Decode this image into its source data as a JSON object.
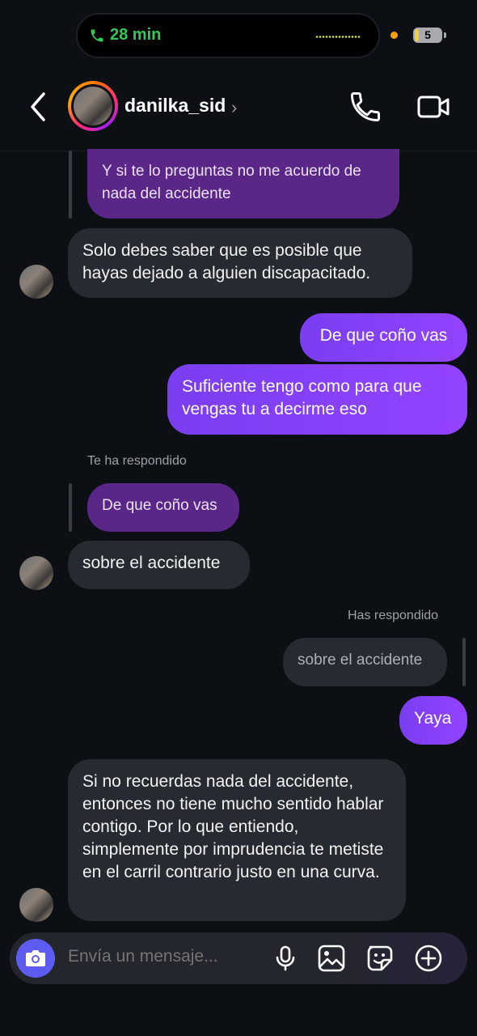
{
  "status_bar": {
    "call_duration": "28 min",
    "battery_level": "5"
  },
  "header": {
    "username": "danilka_sid"
  },
  "messages": [
    {
      "type": "reply-context",
      "text": "Y si te lo preguntas no me acuerdo de nada del accidente"
    },
    {
      "type": "incoming",
      "text": "Solo debes saber que es posible que hayas dejado a alguien discapacitado."
    },
    {
      "type": "outgoing",
      "text": "De que coño vas"
    },
    {
      "type": "outgoing",
      "text": "Suficiente tengo como para que vengas tu a decirme eso"
    },
    {
      "type": "note",
      "text": "Te ha respondido"
    },
    {
      "type": "reply-context",
      "text": "De que coño vas"
    },
    {
      "type": "incoming",
      "text": "sobre el accidente"
    },
    {
      "type": "note",
      "text": "Has respondido"
    },
    {
      "type": "reply-context",
      "text": "sobre el accidente"
    },
    {
      "type": "outgoing",
      "text": "Yaya"
    },
    {
      "type": "incoming",
      "text": "Si no recuerdas nada del accidente, entonces no tiene mucho sentido hablar contigo. Por lo que entiendo, simplemente por imprudencia te metiste en el carril contrario justo en una curva."
    }
  ],
  "composer": {
    "placeholder": "Envía un mensaje..."
  },
  "colors": {
    "accent": "#9343ff",
    "camera_button": "#5e5cf0",
    "call_green": "#34c759"
  }
}
